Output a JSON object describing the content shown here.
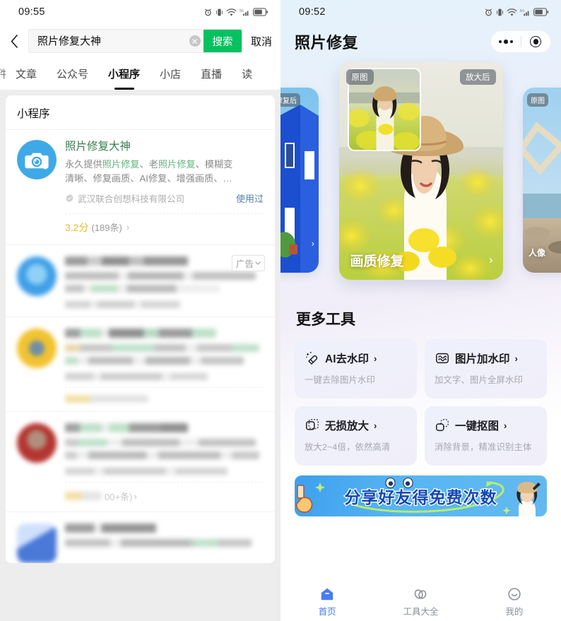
{
  "left": {
    "status": {
      "time": "09:55",
      "icons": [
        "alarm-icon",
        "vibrate-icon",
        "wifi-icon",
        "signal-icon",
        "battery-icon"
      ]
    },
    "search": {
      "back": "back-icon",
      "value": "照片修复大神",
      "placeholder": "搜索",
      "clear": "clear-icon",
      "button_label": "搜索",
      "cancel_label": "取消",
      "accent": "#07c160"
    },
    "tabs": {
      "partial_left": "件",
      "items": [
        "文章",
        "公众号",
        "小程序",
        "小店",
        "直播",
        "读"
      ],
      "active_index": 2
    },
    "results": {
      "section_title": "小程序",
      "main": {
        "icon": "camera-droplet-icon",
        "title": "照片修复大神",
        "desc_1_plain": "永久提供",
        "desc_1_hl_a": "照片修复",
        "desc_1_sep_a": "、老",
        "desc_1_hl_b": "照片修复",
        "desc_1_tail": "、模糊变",
        "desc_2": "清晰、修复画质、AI修复、增强画质、…",
        "company": "武汉联合创想科技有限公司",
        "used_label": "使用过",
        "rating_score": "3.2分",
        "rating_count": "(189条)",
        "chevron": "chevron-right-icon"
      },
      "blurred": [
        {
          "ad_label": "广告",
          "ad_chevron": "chevron-down-icon",
          "icon_color": "#3f9fe8"
        },
        {
          "icon_color": "#f2c330"
        },
        {
          "rating_tail": "00+条)",
          "icon_color": "#b4352f"
        },
        {
          "icon_color": "#4a79d8"
        }
      ]
    }
  },
  "right": {
    "status": {
      "time": "09:52",
      "icons": [
        "alarm-icon",
        "vibrate-icon",
        "wifi-icon",
        "signal-icon",
        "battery-icon"
      ]
    },
    "header": {
      "title": "照片修复",
      "more": "more-dots-icon",
      "close": "target-circle-icon"
    },
    "carousel": {
      "left_slide": {
        "badge": "修复后",
        "chevron": "chevron-right-icon"
      },
      "center_slide": {
        "badge_left": "原图",
        "badge_right": "放大后",
        "label": "画质修复",
        "chevron": "chevron-right-icon"
      },
      "right_slide": {
        "badge": "原图",
        "label": "人像",
        "chevron": "chevron-right-icon"
      }
    },
    "tools": {
      "title": "更多工具",
      "items": [
        {
          "icon": "eraser-sparkle-icon",
          "name": "AI去水印",
          "chevron": "›",
          "sub": "一键去除图片水印"
        },
        {
          "icon": "watermark-wave-icon",
          "name": "图片加水印",
          "chevron": "›",
          "sub": "加文字、图片全屏水印"
        },
        {
          "icon": "expand-frame-icon",
          "name": "无损放大",
          "chevron": "›",
          "sub": "放大2~4倍，依然高清"
        },
        {
          "icon": "cutout-shape-icon",
          "name": "一键抠图",
          "chevron": "›",
          "sub": "消除背景，精准识别主体"
        }
      ]
    },
    "banner": {
      "text": "分享好友得免费次数",
      "accent": "#1447b8"
    },
    "tabbar": {
      "items": [
        {
          "icon": "home-icon",
          "label": "首页",
          "active": true
        },
        {
          "icon": "tools-icon",
          "label": "工具大全",
          "active": false
        },
        {
          "icon": "smiley-icon",
          "label": "我的",
          "active": false
        }
      ],
      "active_color": "#4a7cf0"
    }
  }
}
